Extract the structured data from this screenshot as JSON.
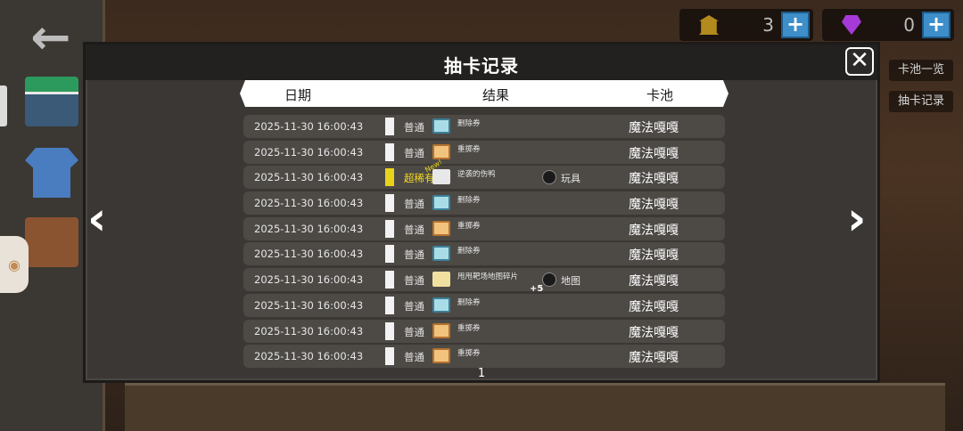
{
  "nav": {
    "back_icon": "←"
  },
  "currency": {
    "gold": {
      "value": "3",
      "plus": "+"
    },
    "gem": {
      "value": "0",
      "plus": "+"
    }
  },
  "side_tabs": [
    "卡池一览",
    "抽卡记录"
  ],
  "modal": {
    "title": "抽卡记录",
    "close": "✕",
    "headers": {
      "date": "日期",
      "result": "结果",
      "pool": "卡池"
    },
    "page": "1",
    "prev_arrow": "‹",
    "next_arrow": "›"
  },
  "rows": [
    {
      "date": "2025-11-30 16:00:43",
      "rarity": "普通",
      "item": "删除券",
      "icon": "delete",
      "pool": "魔法嘎嘎"
    },
    {
      "date": "2025-11-30 16:00:43",
      "rarity": "普通",
      "item": "重掷券",
      "icon": "reset",
      "pool": "魔法嘎嘎"
    },
    {
      "date": "2025-11-30 16:00:43",
      "rarity": "超稀有",
      "item": "逆袭的伤鸭",
      "icon": "skull",
      "new": "New!",
      "extra": "玩具",
      "pool": "魔法嘎嘎"
    },
    {
      "date": "2025-11-30 16:00:43",
      "rarity": "普通",
      "item": "删除券",
      "icon": "delete",
      "pool": "魔法嘎嘎"
    },
    {
      "date": "2025-11-30 16:00:43",
      "rarity": "普通",
      "item": "重掷券",
      "icon": "reset",
      "pool": "魔法嘎嘎"
    },
    {
      "date": "2025-11-30 16:00:43",
      "rarity": "普通",
      "item": "删除券",
      "icon": "delete",
      "pool": "魔法嘎嘎"
    },
    {
      "date": "2025-11-30 16:00:43",
      "rarity": "普通",
      "item": "甩甩靶场地图碎片",
      "icon": "map",
      "qty": "+5",
      "extra": "地图",
      "pool": "魔法嘎嘎"
    },
    {
      "date": "2025-11-30 16:00:43",
      "rarity": "普通",
      "item": "删除券",
      "icon": "delete",
      "pool": "魔法嘎嘎"
    },
    {
      "date": "2025-11-30 16:00:43",
      "rarity": "普通",
      "item": "重掷券",
      "icon": "reset",
      "pool": "魔法嘎嘎"
    },
    {
      "date": "2025-11-30 16:00:43",
      "rarity": "普通",
      "item": "重掷券",
      "icon": "reset",
      "pool": "魔法嘎嘎"
    }
  ],
  "colors": {
    "rare_gold": "#f3d81b",
    "accent_blue": "#3d8ec9"
  }
}
